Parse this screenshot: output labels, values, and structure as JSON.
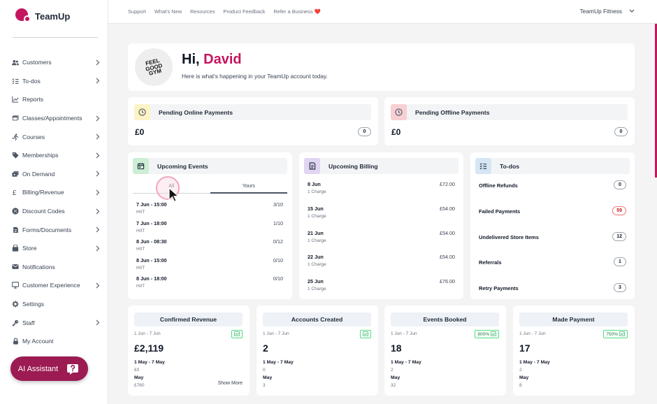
{
  "brand": {
    "name": "TeamUp",
    "accent": "#c4155f"
  },
  "sidebar": {
    "items": [
      {
        "label": "Customers",
        "icon": "users-icon",
        "chevron": true
      },
      {
        "label": "To-dos",
        "icon": "todo-list-icon",
        "chevron": true
      },
      {
        "label": "Reports",
        "icon": "chart-line-icon",
        "chevron": false
      },
      {
        "label": "Classes/Appointments",
        "icon": "calendar-icon",
        "chevron": true
      },
      {
        "label": "Courses",
        "icon": "running-icon",
        "chevron": true
      },
      {
        "label": "Memberships",
        "icon": "tag-icon",
        "chevron": true
      },
      {
        "label": "On Demand",
        "icon": "video-icon",
        "chevron": true
      },
      {
        "label": "Billing/Revenue",
        "icon": "pound-icon",
        "chevron": true
      },
      {
        "label": "Discount Codes",
        "icon": "discount-icon",
        "chevron": true
      },
      {
        "label": "Forms/Documents",
        "icon": "document-icon",
        "chevron": true
      },
      {
        "label": "Store",
        "icon": "store-icon",
        "chevron": true
      },
      {
        "label": "Notifications",
        "icon": "envelope-icon",
        "chevron": false
      },
      {
        "label": "Customer Experience",
        "icon": "monitor-icon",
        "chevron": true
      },
      {
        "label": "Settings",
        "icon": "gear-icon",
        "chevron": false
      },
      {
        "label": "Staff",
        "icon": "key-icon",
        "chevron": true
      },
      {
        "label": "My Account",
        "icon": "lock-icon",
        "chevron": false
      }
    ],
    "ai_assistant": "AI Assistant"
  },
  "topbar": {
    "links": [
      "Support",
      "What's New",
      "Resources",
      "Product Feedback",
      "Refer a Business ❤️"
    ],
    "account": "TeamUp Fitness"
  },
  "welcome": {
    "logo_text": "FEEL GOOD GYM",
    "greeting": "Hi,",
    "name": "David",
    "subtitle": "Here is what's happening in your TeamUp account today."
  },
  "payments": {
    "online": {
      "title": "Pending Online Payments",
      "amount": "£0",
      "count": "0"
    },
    "offline": {
      "title": "Pending Offline Payments",
      "amount": "£0",
      "count": "0"
    }
  },
  "events": {
    "title": "Upcoming Events",
    "tabs": {
      "all": "All",
      "yours": "Yours"
    },
    "items": [
      {
        "time": "7 Jun - 15:00",
        "name": "HIIT",
        "capacity": "3/10"
      },
      {
        "time": "7 Jun - 18:00",
        "name": "HIIT",
        "capacity": "1/10"
      },
      {
        "time": "8 Jun - 08:30",
        "name": "HIIT",
        "capacity": "0/12"
      },
      {
        "time": "8 Jun - 15:00",
        "name": "HIIT",
        "capacity": "0/10"
      },
      {
        "time": "8 Jun - 18:00",
        "name": "HIIT",
        "capacity": "0/10"
      }
    ]
  },
  "billing": {
    "title": "Upcoming Billing",
    "items": [
      {
        "date": "8 Jun",
        "charges": "1 Charge",
        "amount": "£72.00"
      },
      {
        "date": "15 Jun",
        "charges": "1 Charge",
        "amount": "£54.00"
      },
      {
        "date": "21 Jun",
        "charges": "1 Charge",
        "amount": "£54.00"
      },
      {
        "date": "22 Jun",
        "charges": "1 Charge",
        "amount": "£54.00"
      },
      {
        "date": "25 Jun",
        "charges": "1 Charge",
        "amount": "£76.00"
      }
    ]
  },
  "todos": {
    "title": "To-dos",
    "items": [
      {
        "label": "Offline Refunds",
        "count": "0",
        "color": "#111827",
        "border": "#9ca3af"
      },
      {
        "label": "Failed Payments",
        "count": "59",
        "color": "#b91c1c",
        "border": "#f87171"
      },
      {
        "label": "Undelivered Store Items",
        "count": "12",
        "color": "#111827",
        "border": "#9ca3af"
      },
      {
        "label": "Referrals",
        "count": "1",
        "color": "#111827",
        "border": "#9ca3af"
      },
      {
        "label": "Retry Payments",
        "count": "3",
        "color": "#111827",
        "border": "#9ca3af"
      }
    ]
  },
  "stats": [
    {
      "title": "Confirmed Revenue",
      "range": "1 Jun - 7 Jun",
      "badge": "",
      "value": "£2,119",
      "compare_label": "1 May - 7 May",
      "compare_value": "£0",
      "month_label": "May",
      "month_value": "£760",
      "show_more": "Show More"
    },
    {
      "title": "Accounts Created",
      "range": "1 Jun - 7 Jun",
      "badge": "",
      "value": "2",
      "compare_label": "1 May - 7 May",
      "compare_value": "0",
      "month_label": "May",
      "month_value": "3",
      "show_more": ""
    },
    {
      "title": "Events Booked",
      "range": "1 Jun - 7 Jun",
      "badge": "800%",
      "value": "18",
      "compare_label": "1 May - 7 May",
      "compare_value": "2",
      "month_label": "May",
      "month_value": "32",
      "show_more": ""
    },
    {
      "title": "Made Payment",
      "range": "1 Jun - 7 Jun",
      "badge": "750%",
      "value": "17",
      "compare_label": "1 May - 7 May",
      "compare_value": "2",
      "month_label": "May",
      "month_value": "8",
      "show_more": ""
    }
  ]
}
